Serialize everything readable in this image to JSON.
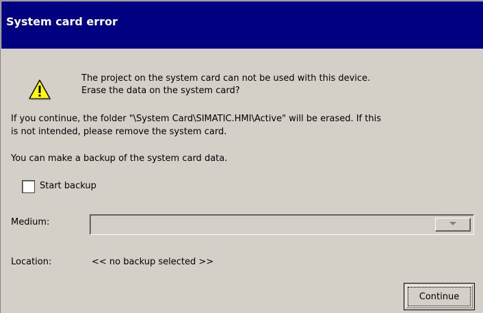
{
  "dialog": {
    "title": "System card error",
    "warning_icon": "warning-triangle-icon",
    "message_line1": "The project on the system card can not be used with this device.",
    "message_line2": "Erase the data on the system card?",
    "info_line1": "If you continue, the folder \"\\System Card\\SIMATIC.HMI\\Active\" will be erased. If this",
    "info_line2": "is not intended, please remove the system card.",
    "backup_info": "You can make a backup of the system card data.",
    "backup_checkbox": {
      "label": "Start backup",
      "checked": false
    },
    "medium": {
      "label": "Medium:",
      "value": "",
      "dropdown_icon": "chevron-down-icon"
    },
    "location": {
      "label": "Location:",
      "value": "<< no backup selected >>"
    },
    "continue_label": "Continue"
  },
  "colors": {
    "titlebar": "#000080",
    "dialog_bg": "#d4d0c8",
    "warning_fill": "#ffff00"
  }
}
